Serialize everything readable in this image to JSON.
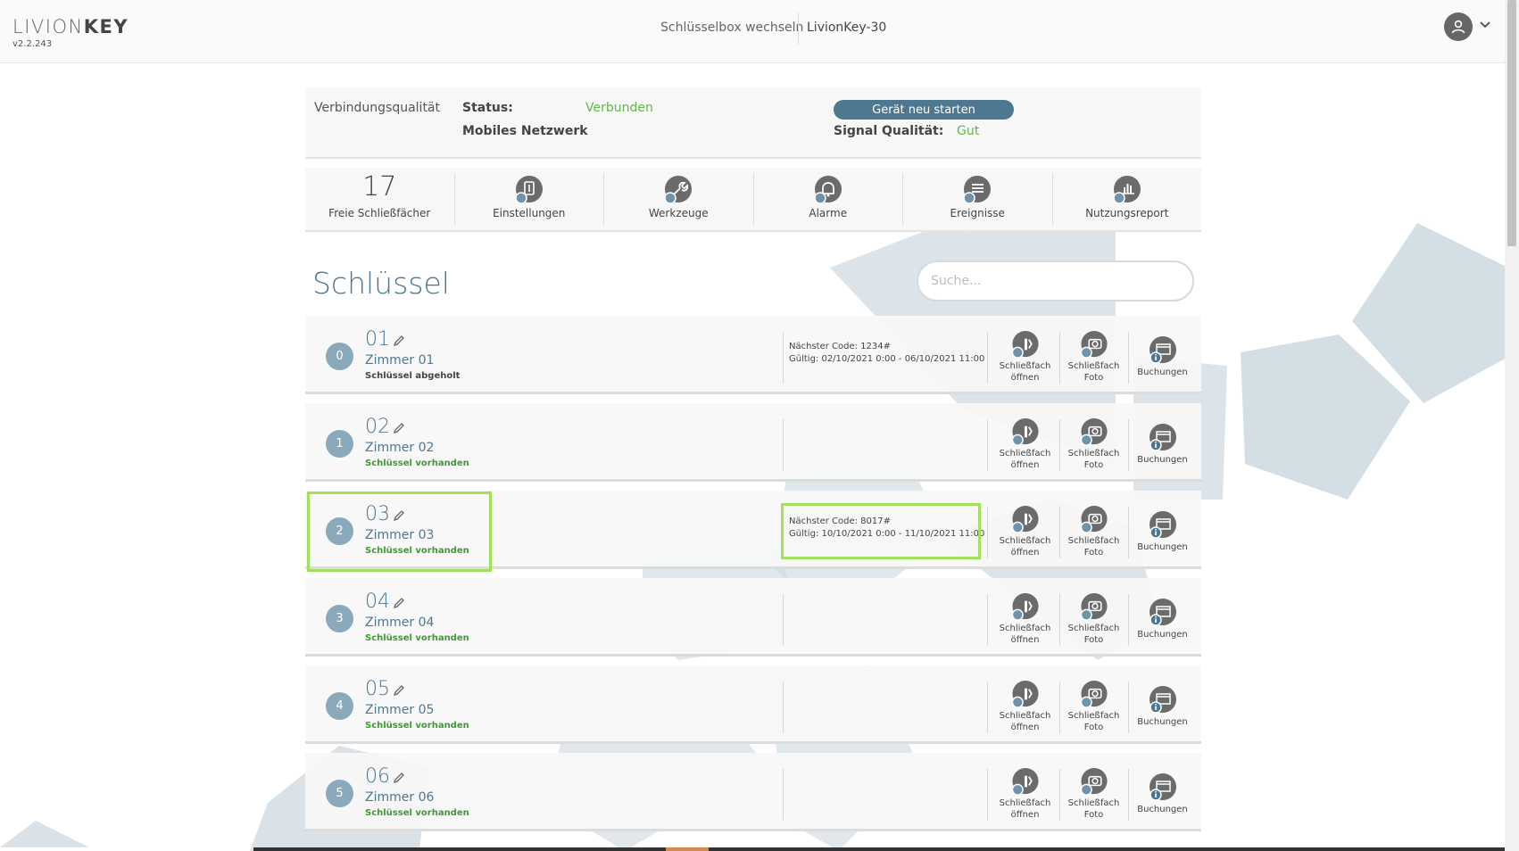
{
  "header": {
    "logo_light": "LIVION",
    "logo_bold": "KEY",
    "version": "v2.2.243",
    "switch_box_label": "Schlüsselbox wechseln",
    "box_name": "LivionKey-30"
  },
  "connection": {
    "title": "Verbindungsqualität",
    "status_label": "Status:",
    "status_value": "Verbunden",
    "network_label": "Mobiles Netzwerk",
    "restart_label": "Gerät neu starten",
    "signal_label": "Signal Qualität:",
    "signal_value": "Gut"
  },
  "tools": [
    {
      "count": "17",
      "label": "Freie Schließfächer"
    },
    {
      "icon": "settings-icon",
      "label": "Einstellungen"
    },
    {
      "icon": "wrench-icon",
      "label": "Werkzeuge"
    },
    {
      "icon": "bell-icon",
      "label": "Alarme"
    },
    {
      "icon": "list-icon",
      "label": "Ereignisse"
    },
    {
      "icon": "bar-chart-icon",
      "label": "Nutzungsreport"
    }
  ],
  "keys_section": {
    "title": "Schlüssel",
    "search_placeholder": "Suche..."
  },
  "actions": {
    "open_line1": "Schließfach",
    "open_line2": "öffnen",
    "photo_line1": "Schließfach",
    "photo_line2": "Foto",
    "bookings": "Buchungen"
  },
  "keys": [
    {
      "index": "0",
      "number": "01",
      "room": "Zimmer 01",
      "status": "Schlüssel abgeholt",
      "status_kind": "picked",
      "code_line1": "Nächster Code: 1234#",
      "code_line2": "Gültig: 02/10/2021 0:00 - 06/10/2021 11:00"
    },
    {
      "index": "1",
      "number": "02",
      "room": "Zimmer 02",
      "status": "Schlüssel vorhanden",
      "status_kind": "present",
      "code_line1": "",
      "code_line2": ""
    },
    {
      "index": "2",
      "number": "03",
      "room": "Zimmer 03",
      "status": "Schlüssel vorhanden",
      "status_kind": "present",
      "code_line1": "Nächster Code: 8017#",
      "code_line2": "Gültig: 10/10/2021 0:00 - 11/10/2021 11:00"
    },
    {
      "index": "3",
      "number": "04",
      "room": "Zimmer 04",
      "status": "Schlüssel vorhanden",
      "status_kind": "present",
      "code_line1": "",
      "code_line2": ""
    },
    {
      "index": "4",
      "number": "05",
      "room": "Zimmer 05",
      "status": "Schlüssel vorhanden",
      "status_kind": "present",
      "code_line1": "",
      "code_line2": ""
    },
    {
      "index": "5",
      "number": "06",
      "room": "Zimmer 06",
      "status": "Schlüssel vorhanden",
      "status_kind": "present",
      "code_line1": "",
      "code_line2": ""
    }
  ],
  "colors": {
    "accent": "#4e7790",
    "status_green": "#62b846",
    "highlight": "#a3e05a"
  }
}
